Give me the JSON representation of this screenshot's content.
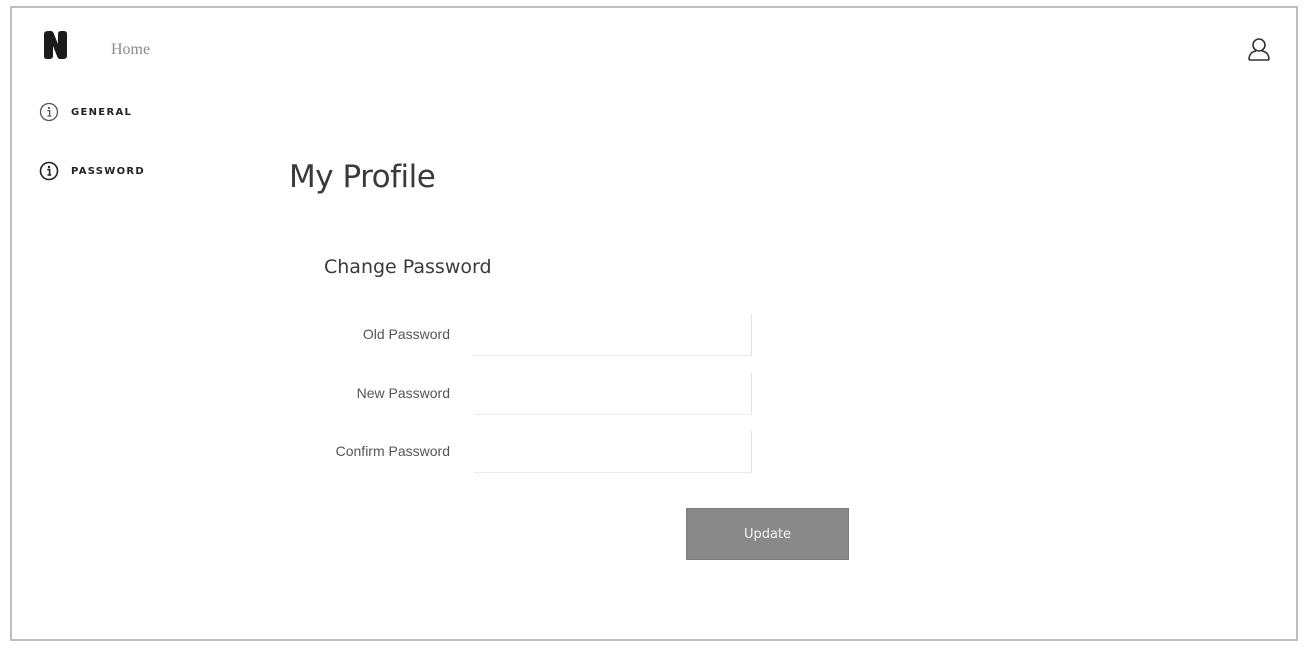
{
  "header": {
    "home_label": "Home",
    "logo_icon": "n-logo-icon",
    "user_icon": "user-icon"
  },
  "sidebar": {
    "items": [
      {
        "label": "GENERAL",
        "icon": "info-icon"
      },
      {
        "label": "PASSWORD",
        "icon": "info-icon"
      }
    ]
  },
  "main": {
    "title": "My Profile",
    "section_title": "Change Password",
    "fields": [
      {
        "label": "Old Password",
        "value": ""
      },
      {
        "label": "New Password",
        "value": ""
      },
      {
        "label": "Confirm Password",
        "value": ""
      }
    ],
    "update_label": "Update"
  },
  "colors": {
    "button_bg": "#898989",
    "button_text": "#f2f2f2",
    "text_dark": "#3a3a3a",
    "muted": "#8a8a8a"
  }
}
